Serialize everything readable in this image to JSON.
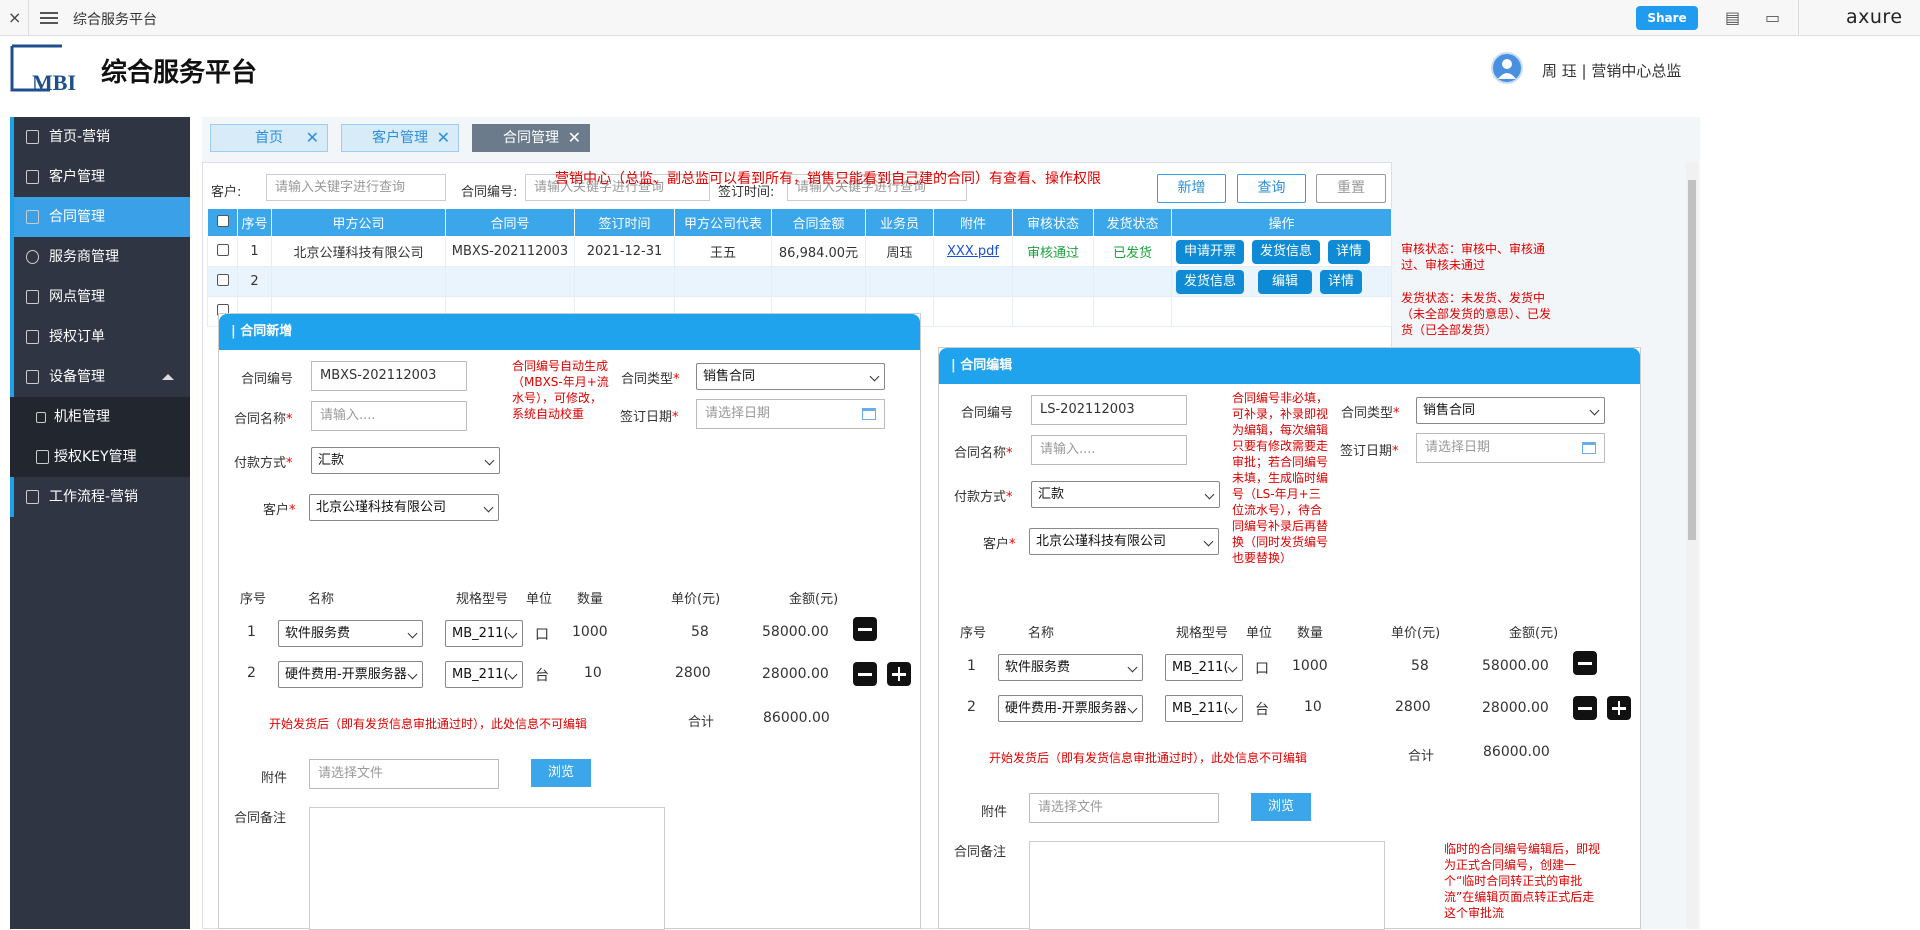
{
  "topbar": {
    "close": "×",
    "title": "综合服务平台",
    "share": "Share",
    "brand": "axure"
  },
  "header": {
    "logo_text": "MBI",
    "app_name": "综合服务平台",
    "user": "周 珏 | 营销中心总监"
  },
  "sidebar": {
    "items": [
      {
        "label": "首页-营销"
      },
      {
        "label": "客户管理"
      },
      {
        "label": "合同管理"
      },
      {
        "label": "服务商管理"
      },
      {
        "label": "网点管理"
      },
      {
        "label": "授权订单"
      },
      {
        "label": "设备管理"
      },
      {
        "label": "机柜管理"
      },
      {
        "label": "授权KEY管理"
      },
      {
        "label": "工作流程-营销"
      }
    ]
  },
  "tabs": [
    {
      "label": "首页"
    },
    {
      "label": "客户管理"
    },
    {
      "label": "合同管理"
    }
  ],
  "tab_close": "✕",
  "filter": {
    "customer_label": "客户:",
    "customer_placeholder": "请输入关键字进行查询",
    "contract_no_label": "合同编号:",
    "contract_no_placeholder": "请输入关键字进行查询",
    "sign_time_label": "签订时间:",
    "sign_time_placeholder": "请输入关键字进行查询",
    "notice": "营销中心（总监、副总监可以看到所有，销售只能看到自己建的合同）有查看、操作权限",
    "btn_new": "新增",
    "btn_query": "查询",
    "btn_reset": "重置"
  },
  "table": {
    "headers": [
      "序号",
      "甲方公司",
      "合同号",
      "签订时间",
      "甲方公司代表",
      "合同金额",
      "业务员",
      "附件",
      "审核状态",
      "发货状态",
      "操作"
    ],
    "row1": {
      "no": "1",
      "company": "北京公瑾科技有限公司",
      "contract": "MBXS-202112003",
      "date": "2021-12-31",
      "rep": "王五",
      "amount": "86,984.00元",
      "sales": "周珏",
      "attach": "XXX.pdf",
      "audit": "审核通过",
      "ship": "已发货",
      "op1": "申请开票",
      "op2": "发货信息",
      "op3": "详情"
    },
    "row2": {
      "no": "2",
      "op1": "发货信息",
      "op2": "编辑",
      "op3": "详情"
    }
  },
  "side_notes": {
    "audit": "审核状态：审核中、审核通过、审核未通过",
    "ship": "发货状态：未发货、发货中（未全部发货的意思）、已发货（已全部发货）"
  },
  "modal_new": {
    "title": "| 合同新增",
    "no_label": "合同编号",
    "no_value": "MBXS-202112003",
    "no_note": "合同编号自动生成（MBXS-年月+流水号），可修改，系统自动校重",
    "type_label": "合同类型",
    "type_value": "销售合同",
    "name_label": "合同名称",
    "name_placeholder": "请输入....",
    "date_label": "签订日期",
    "date_placeholder": "请选择日期",
    "pay_label": "付款方式",
    "pay_value": "汇款",
    "cust_label": "客户",
    "cust_value": "北京公瑾科技有限公司",
    "cols": {
      "no": "序号",
      "name": "名称",
      "spec": "规格型号",
      "unit": "单位",
      "qty": "数量",
      "price": "单价(元)",
      "amount": "金额(元)"
    },
    "items": [
      {
        "no": "1",
        "name": "软件服务费",
        "spec": "MB_211(",
        "unit": "口",
        "qty": "1000",
        "price": "58",
        "amount": "58000.00"
      },
      {
        "no": "2",
        "name": "硬件费用-开票服务器",
        "spec": "MB_211(",
        "unit": "台",
        "qty": "10",
        "price": "2800",
        "amount": "28000.00"
      }
    ],
    "ship_note": "开始发货后（即有发货信息审批通过时），此处信息不可编辑",
    "total_label": "合计",
    "total_value": "86000.00",
    "attach_label": "附件",
    "attach_placeholder": "请选择文件",
    "browse": "浏览",
    "remark_label": "合同备注"
  },
  "modal_edit": {
    "title": "| 合同编辑",
    "no_label": "合同编号",
    "no_value": "LS-202112003",
    "no_note": "合同编号非必填，可补录，补录即视为编辑，每次编辑只要有修改需要走审批；若合同编号未填，生成临时编号（LS-年月+三位流水号），待合同编号补录后再替换（同时发货编号也要替换）",
    "type_label": "合同类型",
    "type_value": "销售合同",
    "name_label": "合同名称",
    "name_placeholder": "请输入....",
    "date_label": "签订日期",
    "date_placeholder": "请选择日期",
    "pay_label": "付款方式",
    "pay_value": "汇款",
    "cust_label": "客户",
    "cust_value": "北京公瑾科技有限公司",
    "cols": {
      "no": "序号",
      "name": "名称",
      "spec": "规格型号",
      "unit": "单位",
      "qty": "数量",
      "price": "单价(元)",
      "amount": "金额(元)"
    },
    "items": [
      {
        "no": "1",
        "name": "软件服务费",
        "spec": "MB_211(",
        "unit": "口",
        "qty": "1000",
        "price": "58",
        "amount": "58000.00"
      },
      {
        "no": "2",
        "name": "硬件费用-开票服务器",
        "spec": "MB_211(",
        "unit": "台",
        "qty": "10",
        "price": "2800",
        "amount": "28000.00"
      }
    ],
    "ship_note": "开始发货后（即有发货信息审批通过时），此处信息不可编辑",
    "total_label": "合计",
    "total_value": "86000.00",
    "attach_label": "附件",
    "attach_placeholder": "请选择文件",
    "browse": "浏览",
    "remark_label": "合同备注",
    "remark_note": "临时的合同编号编辑后，即视为正式合同编号，创建一个“临时合同转正式的审批流”在编辑页面点转正式后走这个审批流"
  },
  "colors": {
    "accent": "#1fa3ec",
    "sidebar": "#2f3542",
    "danger": "#e00000"
  }
}
